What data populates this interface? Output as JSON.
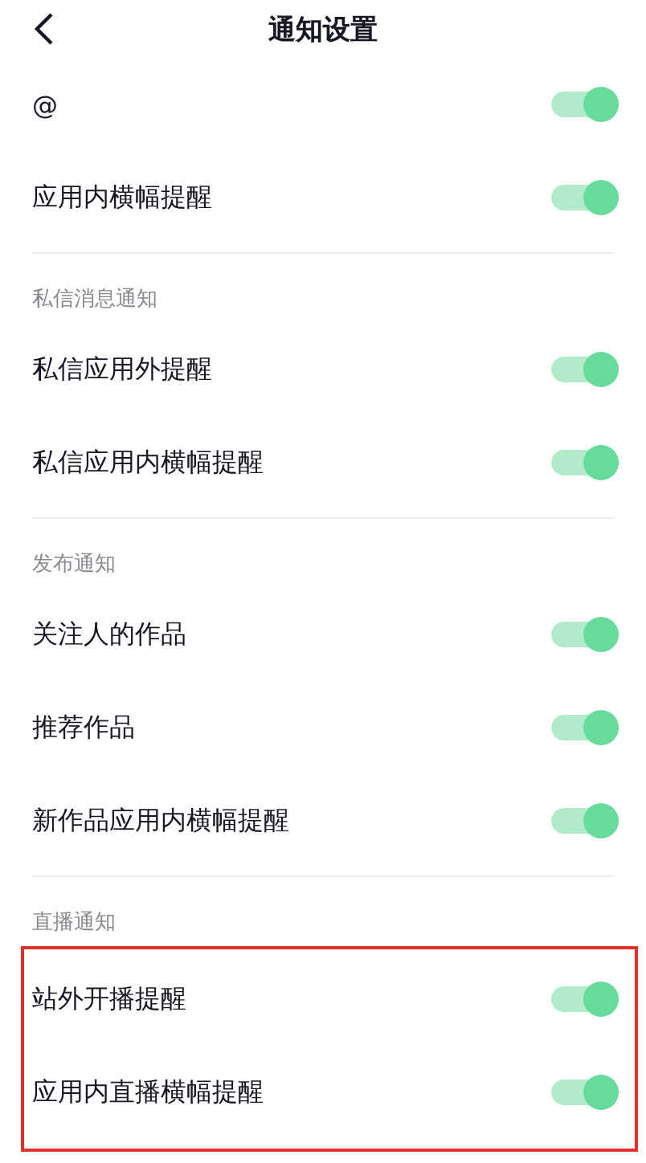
{
  "header": {
    "title": "通知设置"
  },
  "sections": [
    {
      "highlighted": false,
      "items": [
        {
          "label": "@",
          "on": true
        },
        {
          "label": "应用内横幅提醒",
          "on": true
        }
      ]
    },
    {
      "title": "私信消息通知",
      "highlighted": false,
      "items": [
        {
          "label": "私信应用外提醒",
          "on": true
        },
        {
          "label": "私信应用内横幅提醒",
          "on": true
        }
      ]
    },
    {
      "title": "发布通知",
      "highlighted": false,
      "items": [
        {
          "label": "关注人的作品",
          "on": true
        },
        {
          "label": "推荐作品",
          "on": true
        },
        {
          "label": "新作品应用内横幅提醒",
          "on": true
        }
      ]
    },
    {
      "title": "直播通知",
      "highlighted": true,
      "items": [
        {
          "label": "站外开播提醒",
          "on": true
        },
        {
          "label": "应用内直播横幅提醒",
          "on": true
        }
      ]
    }
  ]
}
